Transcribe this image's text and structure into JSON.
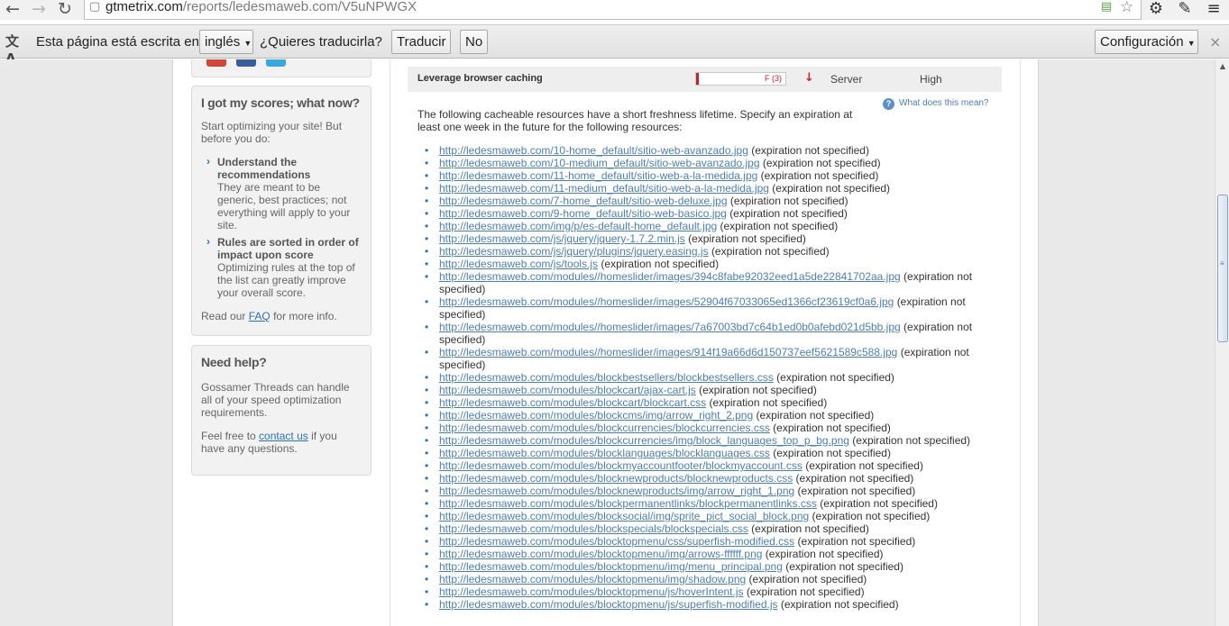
{
  "browser": {
    "url_host": "gtmetrix.com",
    "url_path": "/reports/ledesmaweb.com/V5uNPWGX",
    "icons": [
      "back-icon",
      "forward-icon",
      "reload-icon",
      "page-icon",
      "rss-icon",
      "star-icon",
      "wrench-icon",
      "pen-icon",
      "menu-icon"
    ]
  },
  "translate_bar": {
    "text": "Esta página está escrita en",
    "language": "inglés",
    "question": "¿Quieres traducirla?",
    "translate_label": "Traducir",
    "no_label": "No",
    "settings_label": "Configuración",
    "close_label": "×"
  },
  "sidebar": {
    "scores_box": {
      "title": "I got my scores; what now?",
      "intro": "Start optimizing your site! But before you do:",
      "items": [
        {
          "title": "Understand the recommendations",
          "text": "They are meant to be generic, best practices; not everything will apply to your site."
        },
        {
          "title": "Rules are sorted in order of impact upon score",
          "text": "Optimizing rules at the top of the list can greatly improve your overall score."
        }
      ],
      "faq_prefix": "Read our",
      "faq_link": "FAQ",
      "faq_suffix": "for more info."
    },
    "help_box": {
      "title": "Need help?",
      "text": "Gossamer Threads can handle all of your speed optimization requirements.",
      "contact_prefix": "Feel free to",
      "contact_link": "contact us",
      "contact_suffix": "if you have any questions."
    }
  },
  "rule": {
    "name": "Leverage browser caching",
    "grade_label": "F (3)",
    "score": 3,
    "type": "Server",
    "priority": "High",
    "arrow": "↓",
    "help_link": "What does this mean?",
    "intro": "The following cacheable resources have a short freshness lifetime. Specify an expiration at least one week in the future for the following resources:",
    "note": "(expiration not specified)",
    "resources": [
      "http://ledesmaweb.com/10-home_default/sitio-web-avanzado.jpg",
      "http://ledesmaweb.com/10-medium_default/sitio-web-avanzado.jpg",
      "http://ledesmaweb.com/11-home_default/sitio-web-a-la-medida.jpg",
      "http://ledesmaweb.com/11-medium_default/sitio-web-a-la-medida.jpg",
      "http://ledesmaweb.com/7-home_default/sitio-web-deluxe.jpg",
      "http://ledesmaweb.com/9-home_default/sitio-web-basico.jpg",
      "http://ledesmaweb.com/img/p/es-default-home_default.jpg",
      "http://ledesmaweb.com/js/jquery/jquery-1.7.2.min.js",
      "http://ledesmaweb.com/js/jquery/plugins/jquery.easing.js",
      "http://ledesmaweb.com/js/tools.js",
      "http://ledesmaweb.com/modules//homeslider/images/394c8fabe92032eed1a5de22841702aa.jpg",
      "http://ledesmaweb.com/modules//homeslider/images/52904f67033065ed1366cf23619cf0a6.jpg",
      "http://ledesmaweb.com/modules//homeslider/images/7a67003bd7c64b1ed0b0afebd021d5bb.jpg",
      "http://ledesmaweb.com/modules//homeslider/images/914f19a66d6d150737eef5621589c588.jpg",
      "http://ledesmaweb.com/modules/blockbestsellers/blockbestsellers.css",
      "http://ledesmaweb.com/modules/blockcart/ajax-cart.js",
      "http://ledesmaweb.com/modules/blockcart/blockcart.css",
      "http://ledesmaweb.com/modules/blockcms/img/arrow_right_2.png",
      "http://ledesmaweb.com/modules/blockcurrencies/blockcurrencies.css",
      "http://ledesmaweb.com/modules/blockcurrencies/img/block_languages_top_p_bg.png",
      "http://ledesmaweb.com/modules/blocklanguages/blocklanguages.css",
      "http://ledesmaweb.com/modules/blockmyaccountfooter/blockmyaccount.css",
      "http://ledesmaweb.com/modules/blocknewproducts/blocknewproducts.css",
      "http://ledesmaweb.com/modules/blocknewproducts/img/arrow_right_1.png",
      "http://ledesmaweb.com/modules/blockpermanentlinks/blockpermanentlinks.css",
      "http://ledesmaweb.com/modules/blocksocial/img/sprite_pict_social_block.png",
      "http://ledesmaweb.com/modules/blockspecials/blockspecials.css",
      "http://ledesmaweb.com/modules/blocktopmenu/css/superfish-modified.css",
      "http://ledesmaweb.com/modules/blocktopmenu/img/arrows-ffffff.png",
      "http://ledesmaweb.com/modules/blocktopmenu/img/menu_principal.png",
      "http://ledesmaweb.com/modules/blocktopmenu/img/shadow.png",
      "http://ledesmaweb.com/modules/blocktopmenu/js/hoverIntent.js",
      "http://ledesmaweb.com/modules/blocktopmenu/js/superfish-modified.js"
    ]
  },
  "colors": {
    "link": "#4d7eb3",
    "grade_bad": "#c8202a",
    "sidebar_bg": "#f2f2f2"
  }
}
